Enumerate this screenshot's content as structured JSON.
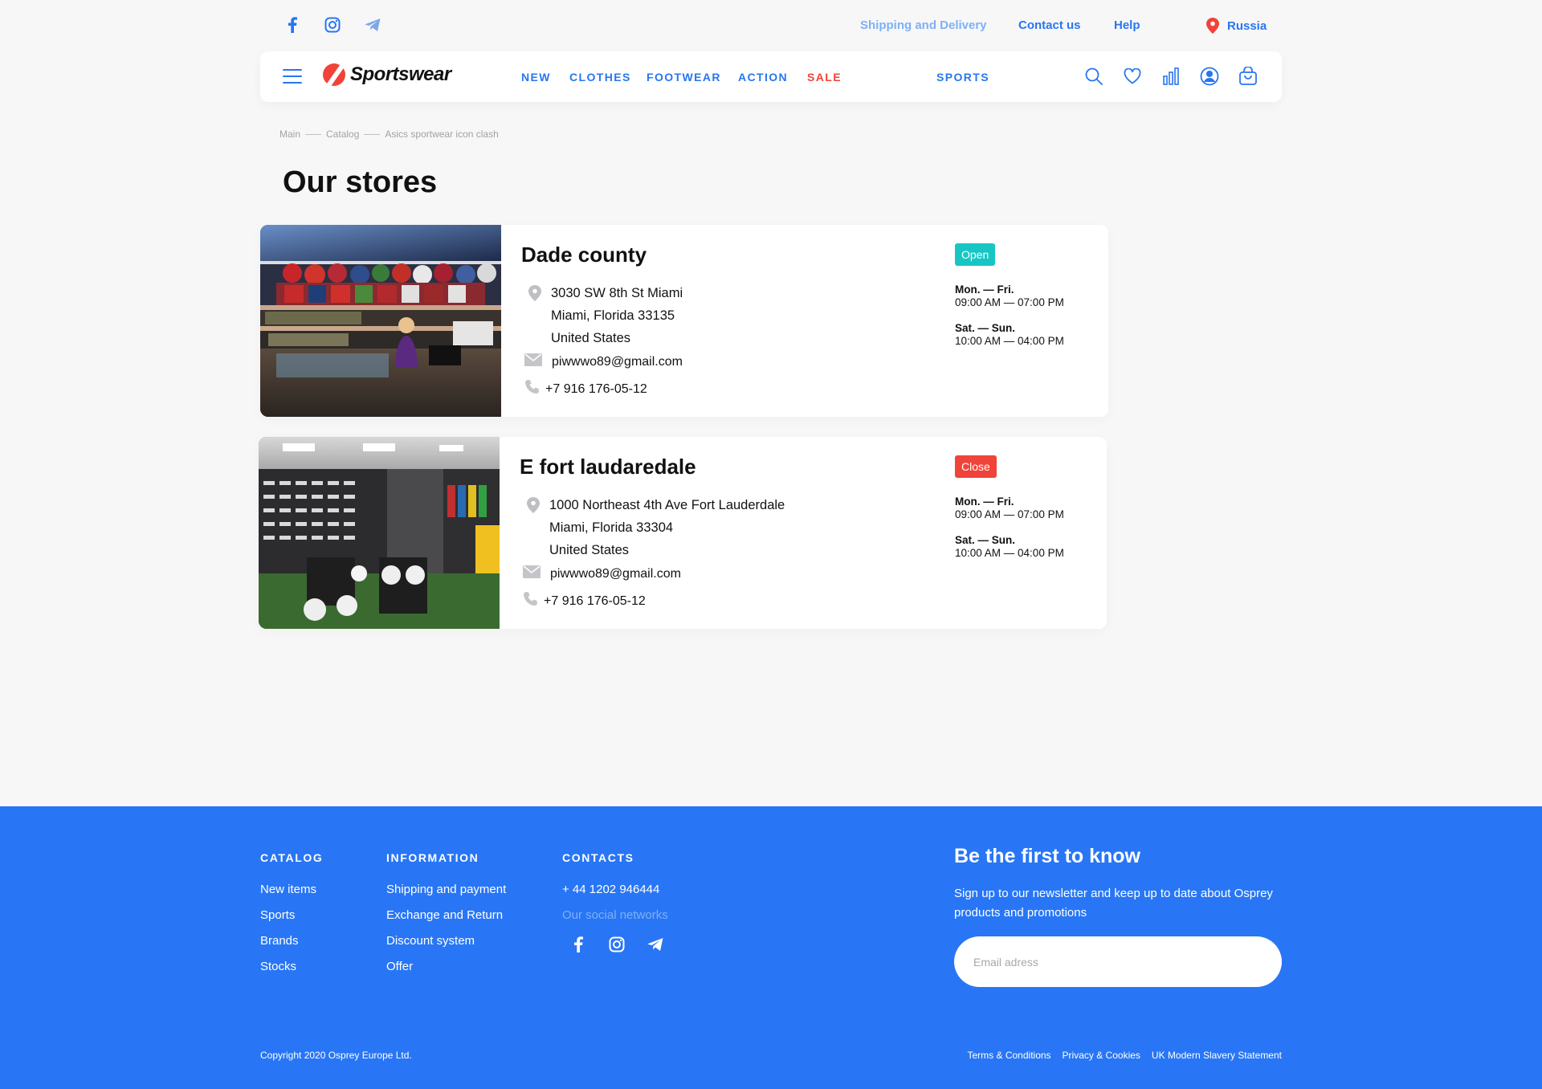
{
  "topbar": {
    "social": [
      "facebook-icon",
      "instagram-icon",
      "telegram-icon"
    ],
    "links": {
      "shipping": "Shipping and Delivery",
      "contact": "Contact us",
      "help": "Help"
    },
    "region": "Russia"
  },
  "header": {
    "logo": "Sportswear",
    "menu": {
      "new": "NEW",
      "clothes": "CLOTHES",
      "footwear": "FOOTWEAR",
      "action": "ACTION",
      "sale": "SALE",
      "sports": "SPORTS"
    },
    "icons": [
      "search-icon",
      "heart-icon",
      "compare-icon",
      "user-icon",
      "cart-icon"
    ]
  },
  "breadcrumb": [
    "Main",
    "Catalog",
    "Asics sportwear icon clash"
  ],
  "page_title": "Our stores",
  "stores": [
    {
      "name": "Dade county",
      "address": [
        "3030 SW 8th St Miami",
        "Miami, Florida 33135",
        "United States"
      ],
      "email": "piwwwo89@gmail.com",
      "phone": "+7 916 176-05-12",
      "status": "Open",
      "weekdays_label": "Mon. — Fri.",
      "weekdays_hours": "09:00 AM — 07:00 PM",
      "weekend_label": "Sat. — Sun.",
      "weekend_hours": "10:00 AM — 04:00 PM"
    },
    {
      "name": "E fort laudaredale",
      "address": [
        "1000 Northeast 4th Ave Fort Lauderdale",
        "Miami, Florida 33304",
        "United States"
      ],
      "email": "piwwwo89@gmail.com",
      "phone": "+7 916 176-05-12",
      "status": "Close",
      "weekdays_label": "Mon. — Fri.",
      "weekdays_hours": "09:00 AM — 07:00 PM",
      "weekend_label": "Sat. — Sun.",
      "weekend_hours": "10:00 AM — 04:00 PM"
    }
  ],
  "footer": {
    "catalog": {
      "title": "CATALOG",
      "items": [
        "New items",
        "Sports",
        "Brands",
        "Stocks"
      ]
    },
    "information": {
      "title": "INFORMATION",
      "items": [
        "Shipping and payment",
        "Exchange and Return",
        "Discount system",
        "Offer"
      ]
    },
    "contacts": {
      "title": "CONTACTS",
      "phone": "+ 44 1202 946444",
      "social_label": "Our social networks"
    },
    "newsletter": {
      "title": "Be the first to know",
      "text": "Sign up to our newsletter and keep up to date about Osprey products and promotions",
      "placeholder": "Email adress"
    },
    "copyright": "Copyright 2020 Osprey Europe Ltd.",
    "legal": [
      "Terms & Conditions",
      "Privacy & Cookies",
      "UK Modern Slavery Statement"
    ]
  },
  "colors": {
    "accent": "#2876f0",
    "sale": "#f0443a",
    "open": "#17c6c4",
    "footer": "#2876f5"
  }
}
